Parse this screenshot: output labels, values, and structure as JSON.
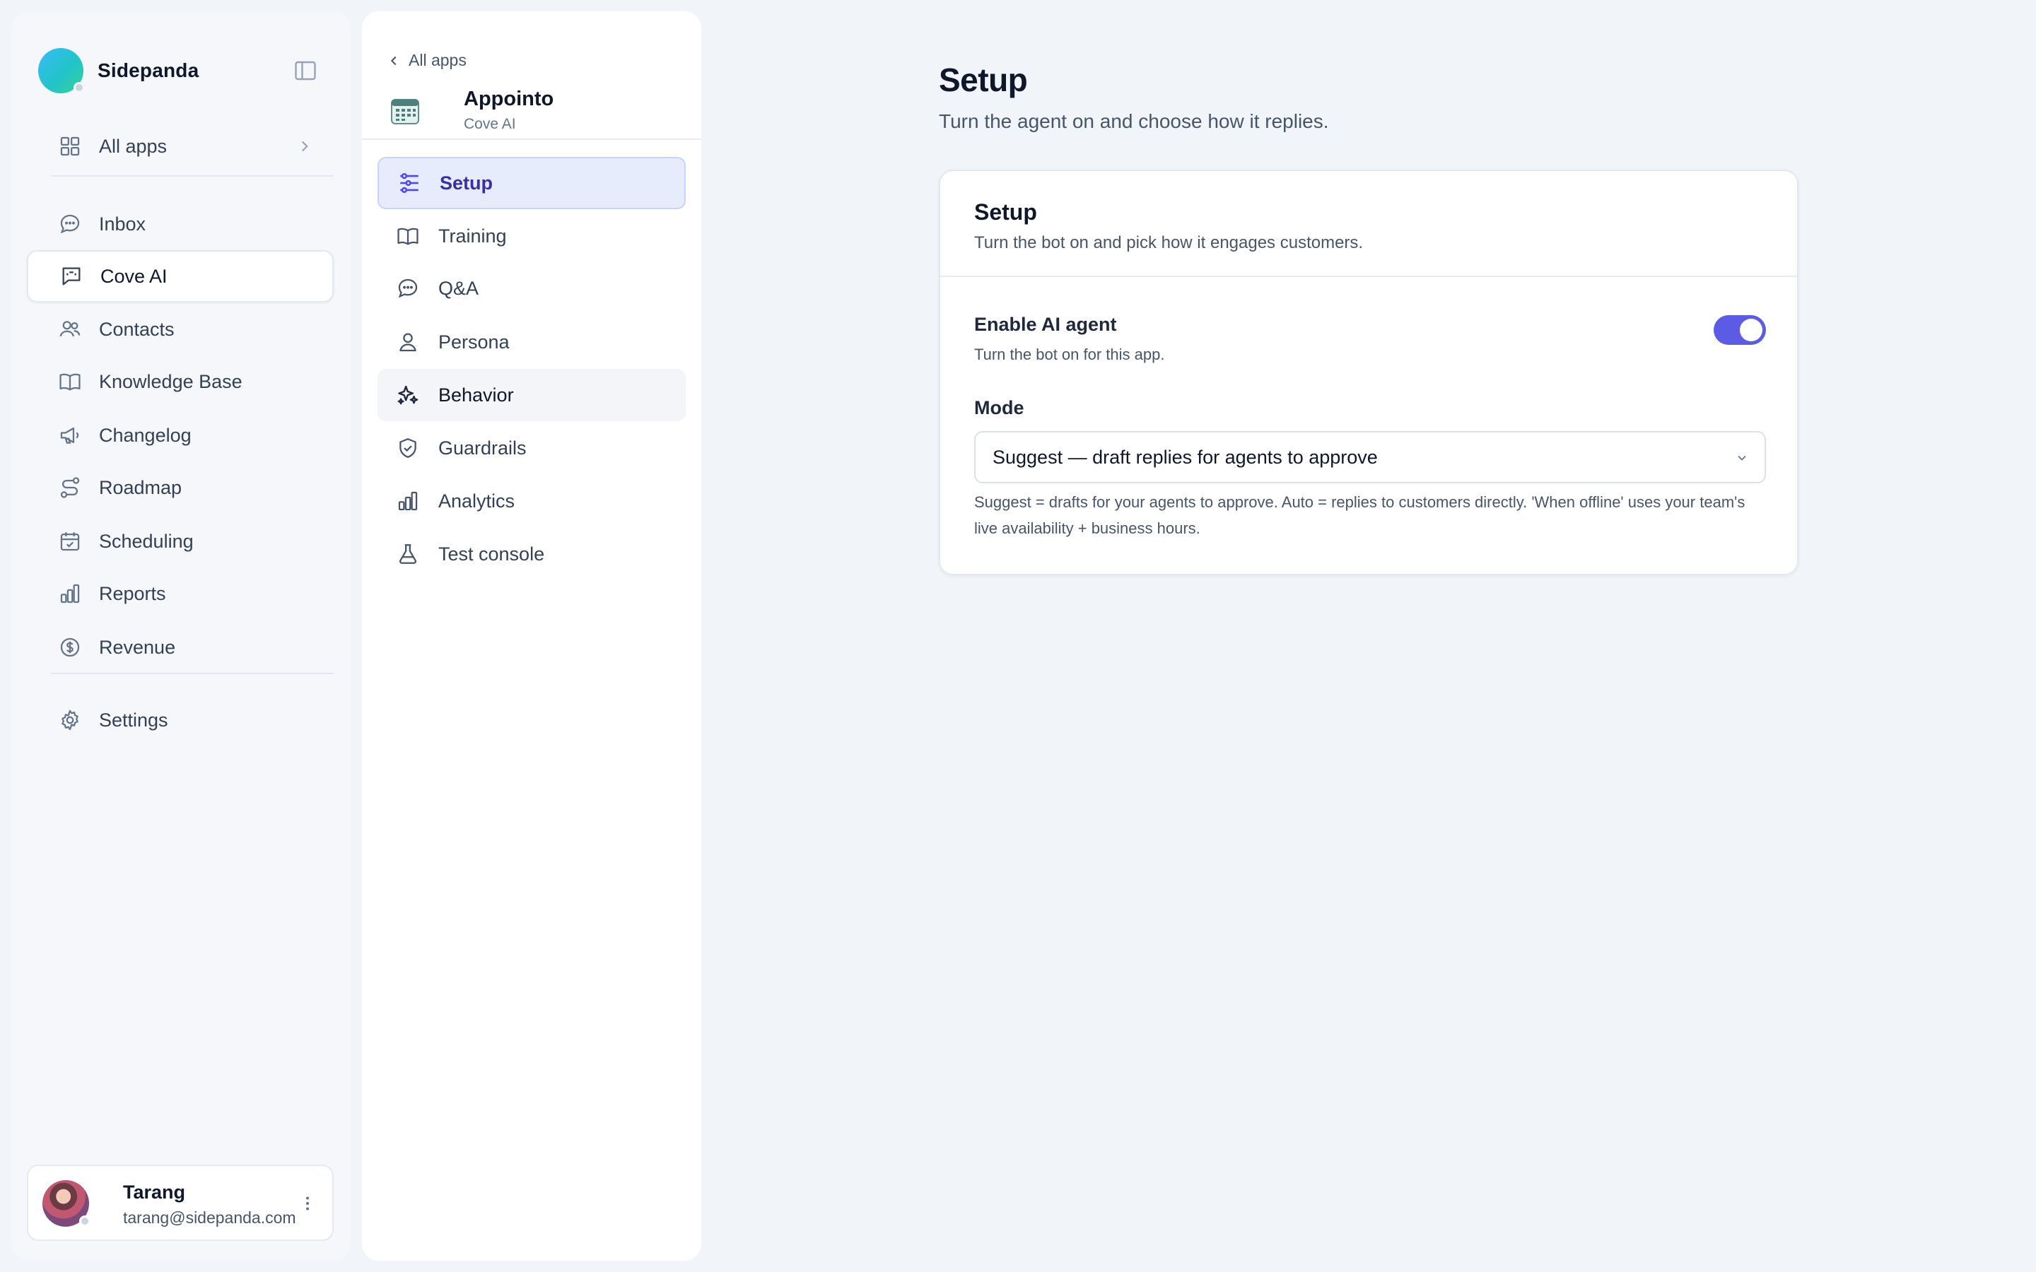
{
  "brand": {
    "name": "Sidepanda"
  },
  "sidebar": {
    "all_apps": "All apps",
    "items": [
      {
        "label": "Inbox",
        "icon": "chat-bubble-icon"
      },
      {
        "label": "Cove AI",
        "icon": "bot-message-icon",
        "active": true
      },
      {
        "label": "Contacts",
        "icon": "users-icon"
      },
      {
        "label": "Knowledge Base",
        "icon": "book-icon"
      },
      {
        "label": "Changelog",
        "icon": "megaphone-icon"
      },
      {
        "label": "Roadmap",
        "icon": "route-icon"
      },
      {
        "label": "Scheduling",
        "icon": "calendar-check-icon"
      },
      {
        "label": "Reports",
        "icon": "bar-chart-icon"
      },
      {
        "label": "Revenue",
        "icon": "dollar-circle-icon"
      }
    ],
    "settings": "Settings"
  },
  "user": {
    "name": "Tarang",
    "email": "tarang@sidepanda.com"
  },
  "panel": {
    "back": "All apps",
    "app_name": "Appointo",
    "app_sub": "Cove AI",
    "items": [
      {
        "label": "Setup",
        "icon": "sliders-icon",
        "state": "active"
      },
      {
        "label": "Training",
        "icon": "book-icon"
      },
      {
        "label": "Q&A",
        "icon": "chat-bubble-icon"
      },
      {
        "label": "Persona",
        "icon": "user-icon"
      },
      {
        "label": "Behavior",
        "icon": "sparkles-icon",
        "state": "hover"
      },
      {
        "label": "Guardrails",
        "icon": "shield-check-icon"
      },
      {
        "label": "Analytics",
        "icon": "bar-chart-icon"
      },
      {
        "label": "Test console",
        "icon": "flask-icon"
      }
    ]
  },
  "main": {
    "title": "Setup",
    "subtitle": "Turn the agent on and choose how it replies.",
    "card": {
      "title": "Setup",
      "subtitle": "Turn the bot on and pick how it engages customers.",
      "enable_label": "Enable AI agent",
      "enable_help": "Turn the bot on for this app.",
      "enable_on": true,
      "mode_label": "Mode",
      "mode_value": "Suggest — draft replies for agents to approve",
      "mode_help": "Suggest = drafts for your agents to approve. Auto = replies to customers directly. 'When offline' uses your team's live availability + business hours."
    }
  },
  "colors": {
    "accent": "#5b5be6",
    "active_bg": "#e7ecfc",
    "page_bg": "#f1f4f9"
  }
}
